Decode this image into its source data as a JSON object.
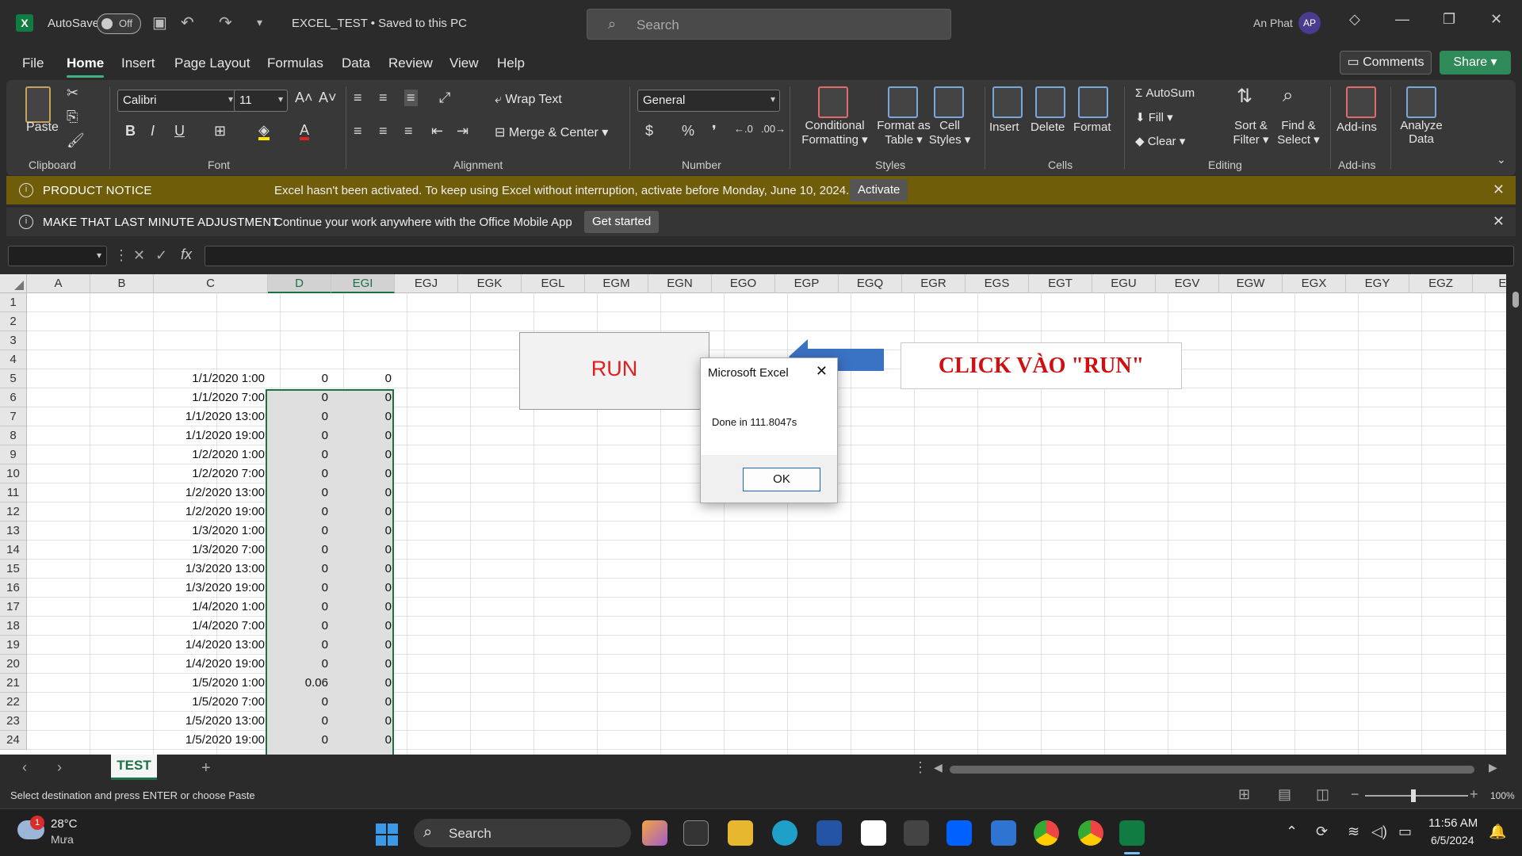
{
  "titlebar": {
    "autosave_label": "AutoSave",
    "autosave_state": "Off",
    "doc_title": "EXCEL_TEST • Saved to this PC",
    "search_placeholder": "Search",
    "user_name": "An Phat",
    "user_initials": "AP"
  },
  "menu": {
    "tabs": [
      "File",
      "Home",
      "Insert",
      "Page Layout",
      "Formulas",
      "Data",
      "Review",
      "View",
      "Help"
    ],
    "active": "Home",
    "comments": "Comments",
    "share": "Share"
  },
  "ribbon": {
    "clipboard": {
      "paste": "Paste",
      "label": "Clipboard"
    },
    "font": {
      "name": "Calibri",
      "size": "11",
      "label": "Font"
    },
    "alignment": {
      "wrap": "Wrap Text",
      "merge": "Merge & Center",
      "label": "Alignment"
    },
    "number": {
      "format": "General",
      "label": "Number"
    },
    "styles": {
      "conditional": "Conditional",
      "conditional2": "Formatting",
      "format_as": "Format as",
      "table": "Table",
      "cell": "Cell",
      "styles": "Styles",
      "label": "Styles"
    },
    "cells": {
      "insert": "Insert",
      "delete": "Delete",
      "format": "Format",
      "label": "Cells"
    },
    "editing": {
      "autosum": "AutoSum",
      "fill": "Fill",
      "clear": "Clear",
      "sort": "Sort &",
      "filter": "Filter",
      "find": "Find &",
      "select": "Select",
      "label": "Editing"
    },
    "addins": {
      "addins": "Add-ins",
      "label": "Add-ins"
    },
    "analyze": {
      "line1": "Analyze",
      "line2": "Data"
    }
  },
  "notices": {
    "product": {
      "title": "PRODUCT NOTICE",
      "message": "Excel hasn't been activated. To keep using Excel without interruption, activate before Monday, June 10, 2024.",
      "button": "Activate"
    },
    "mobile": {
      "title": "MAKE THAT LAST MINUTE ADJUSTMENT",
      "message": "Continue your work anywhere with the Office Mobile App",
      "button": "Get started"
    }
  },
  "formula_bar": {
    "fx": "fx"
  },
  "grid": {
    "columns": [
      "A",
      "B",
      "C",
      "D",
      "EGI",
      "EGJ",
      "EGK",
      "EGL",
      "EGM",
      "EGN",
      "EGO",
      "EGP",
      "EGQ",
      "EGR",
      "EGS",
      "EGT",
      "EGU",
      "EGV",
      "EGW",
      "EGX",
      "EGY",
      "EGZ",
      "EI"
    ],
    "selected_columns": [
      "D",
      "EGI"
    ],
    "rows": [
      "1",
      "2",
      "3",
      "4",
      "5",
      "6",
      "7",
      "8",
      "9",
      "10",
      "11",
      "12",
      "13",
      "14",
      "15",
      "16",
      "17",
      "18",
      "19",
      "20",
      "21",
      "22",
      "23",
      "24"
    ],
    "data": [
      {
        "c": "1/1/2020 1:00",
        "d": "0",
        "egi": "0"
      },
      {
        "c": "1/1/2020 7:00",
        "d": "0",
        "egi": "0"
      },
      {
        "c": "1/1/2020 13:00",
        "d": "0",
        "egi": "0"
      },
      {
        "c": "1/1/2020 19:00",
        "d": "0",
        "egi": "0"
      },
      {
        "c": "1/2/2020 1:00",
        "d": "0",
        "egi": "0"
      },
      {
        "c": "1/2/2020 7:00",
        "d": "0",
        "egi": "0"
      },
      {
        "c": "1/2/2020 13:00",
        "d": "0",
        "egi": "0"
      },
      {
        "c": "1/2/2020 19:00",
        "d": "0",
        "egi": "0"
      },
      {
        "c": "1/3/2020 1:00",
        "d": "0",
        "egi": "0"
      },
      {
        "c": "1/3/2020 7:00",
        "d": "0",
        "egi": "0"
      },
      {
        "c": "1/3/2020 13:00",
        "d": "0",
        "egi": "0"
      },
      {
        "c": "1/3/2020 19:00",
        "d": "0",
        "egi": "0"
      },
      {
        "c": "1/4/2020 1:00",
        "d": "0",
        "egi": "0"
      },
      {
        "c": "1/4/2020 7:00",
        "d": "0",
        "egi": "0"
      },
      {
        "c": "1/4/2020 13:00",
        "d": "0",
        "egi": "0"
      },
      {
        "c": "1/4/2020 19:00",
        "d": "0",
        "egi": "0"
      },
      {
        "c": "1/5/2020 1:00",
        "d": "0.06",
        "egi": "0"
      },
      {
        "c": "1/5/2020 7:00",
        "d": "0",
        "egi": "0"
      },
      {
        "c": "1/5/2020 13:00",
        "d": "0",
        "egi": "0"
      },
      {
        "c": "1/5/2020 19:00",
        "d": "0",
        "egi": "0"
      }
    ],
    "run_button": "RUN",
    "instruction": "CLICK VÀO \"RUN\""
  },
  "dialog": {
    "title": "Microsoft Excel",
    "message": "Done in 111.8047s",
    "ok": "OK"
  },
  "sheets": {
    "tabs": [
      "TEST"
    ],
    "active": "TEST"
  },
  "status": {
    "message": "Select destination and press ENTER or choose Paste",
    "zoom": "100%"
  },
  "taskbar": {
    "weather_temp": "28°C",
    "weather_desc": "Mưa",
    "weather_badge": "1",
    "search_placeholder": "Search",
    "time": "11:56 AM",
    "date": "6/5/2024"
  },
  "colors": {
    "accent": "#1e7145",
    "run_text": "#e02020",
    "notice_bg": "#6f5d0a",
    "arrow": "#3a72c4"
  }
}
